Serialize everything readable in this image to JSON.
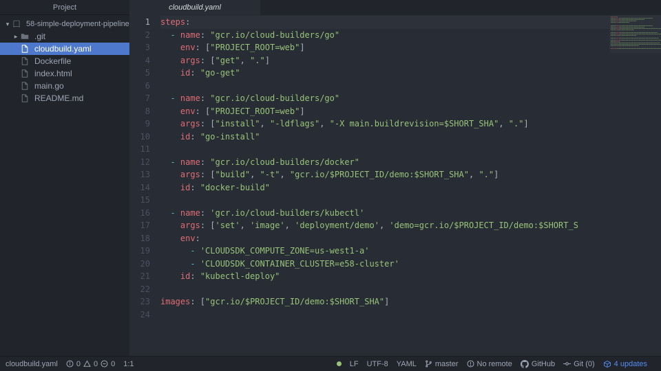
{
  "sidebar": {
    "title": "Project",
    "project": "58-simple-deployment-pipeline",
    "items": [
      {
        "name": ".git",
        "type": "folder"
      },
      {
        "name": "cloudbuild.yaml",
        "type": "file",
        "selected": true
      },
      {
        "name": "Dockerfile",
        "type": "file"
      },
      {
        "name": "index.html",
        "type": "file"
      },
      {
        "name": "main.go",
        "type": "file"
      },
      {
        "name": "README.md",
        "type": "file"
      }
    ]
  },
  "tab": {
    "name": "cloudbuild.yaml"
  },
  "code": {
    "lines": [
      [
        {
          "t": "steps",
          "c": "k"
        },
        {
          "t": ":",
          "c": "p"
        }
      ],
      [
        {
          "t": "  ",
          "c": "p"
        },
        {
          "t": "- ",
          "c": "d"
        },
        {
          "t": "name",
          "c": "k"
        },
        {
          "t": ": ",
          "c": "p"
        },
        {
          "t": "\"gcr.io/cloud-builders/go\"",
          "c": "s"
        }
      ],
      [
        {
          "t": "    ",
          "c": "p"
        },
        {
          "t": "env",
          "c": "k"
        },
        {
          "t": ": [",
          "c": "p"
        },
        {
          "t": "\"PROJECT_ROOT=web\"",
          "c": "s"
        },
        {
          "t": "]",
          "c": "p"
        }
      ],
      [
        {
          "t": "    ",
          "c": "p"
        },
        {
          "t": "args",
          "c": "k"
        },
        {
          "t": ": [",
          "c": "p"
        },
        {
          "t": "\"get\"",
          "c": "s"
        },
        {
          "t": ", ",
          "c": "p"
        },
        {
          "t": "\".\"",
          "c": "s"
        },
        {
          "t": "]",
          "c": "p"
        }
      ],
      [
        {
          "t": "    ",
          "c": "p"
        },
        {
          "t": "id",
          "c": "k"
        },
        {
          "t": ": ",
          "c": "p"
        },
        {
          "t": "\"go-get\"",
          "c": "s"
        }
      ],
      [],
      [
        {
          "t": "  ",
          "c": "p"
        },
        {
          "t": "- ",
          "c": "d"
        },
        {
          "t": "name",
          "c": "k"
        },
        {
          "t": ": ",
          "c": "p"
        },
        {
          "t": "\"gcr.io/cloud-builders/go\"",
          "c": "s"
        }
      ],
      [
        {
          "t": "    ",
          "c": "p"
        },
        {
          "t": "env",
          "c": "k"
        },
        {
          "t": ": [",
          "c": "p"
        },
        {
          "t": "\"PROJECT_ROOT=web\"",
          "c": "s"
        },
        {
          "t": "]",
          "c": "p"
        }
      ],
      [
        {
          "t": "    ",
          "c": "p"
        },
        {
          "t": "args",
          "c": "k"
        },
        {
          "t": ": [",
          "c": "p"
        },
        {
          "t": "\"install\"",
          "c": "s"
        },
        {
          "t": ", ",
          "c": "p"
        },
        {
          "t": "\"-ldflags\"",
          "c": "s"
        },
        {
          "t": ", ",
          "c": "p"
        },
        {
          "t": "\"-X main.buildrevision=$SHORT_SHA\"",
          "c": "s"
        },
        {
          "t": ", ",
          "c": "p"
        },
        {
          "t": "\".\"",
          "c": "s"
        },
        {
          "t": "]",
          "c": "p"
        }
      ],
      [
        {
          "t": "    ",
          "c": "p"
        },
        {
          "t": "id",
          "c": "k"
        },
        {
          "t": ": ",
          "c": "p"
        },
        {
          "t": "\"go-install\"",
          "c": "s"
        }
      ],
      [],
      [
        {
          "t": "  ",
          "c": "p"
        },
        {
          "t": "- ",
          "c": "d"
        },
        {
          "t": "name",
          "c": "k"
        },
        {
          "t": ": ",
          "c": "p"
        },
        {
          "t": "\"gcr.io/cloud-builders/docker\"",
          "c": "s"
        }
      ],
      [
        {
          "t": "    ",
          "c": "p"
        },
        {
          "t": "args",
          "c": "k"
        },
        {
          "t": ": [",
          "c": "p"
        },
        {
          "t": "\"build\"",
          "c": "s"
        },
        {
          "t": ", ",
          "c": "p"
        },
        {
          "t": "\"-t\"",
          "c": "s"
        },
        {
          "t": ", ",
          "c": "p"
        },
        {
          "t": "\"gcr.io/$PROJECT_ID/demo:$SHORT_SHA\"",
          "c": "s"
        },
        {
          "t": ", ",
          "c": "p"
        },
        {
          "t": "\".\"",
          "c": "s"
        },
        {
          "t": "]",
          "c": "p"
        }
      ],
      [
        {
          "t": "    ",
          "c": "p"
        },
        {
          "t": "id",
          "c": "k"
        },
        {
          "t": ": ",
          "c": "p"
        },
        {
          "t": "\"docker-build\"",
          "c": "s"
        }
      ],
      [],
      [
        {
          "t": "  ",
          "c": "p"
        },
        {
          "t": "- ",
          "c": "d"
        },
        {
          "t": "name",
          "c": "k"
        },
        {
          "t": ": ",
          "c": "p"
        },
        {
          "t": "'gcr.io/cloud-builders/kubectl'",
          "c": "s"
        }
      ],
      [
        {
          "t": "    ",
          "c": "p"
        },
        {
          "t": "args",
          "c": "k"
        },
        {
          "t": ": [",
          "c": "p"
        },
        {
          "t": "'set'",
          "c": "s"
        },
        {
          "t": ", ",
          "c": "p"
        },
        {
          "t": "'image'",
          "c": "s"
        },
        {
          "t": ", ",
          "c": "p"
        },
        {
          "t": "'deployment/demo'",
          "c": "s"
        },
        {
          "t": ", ",
          "c": "p"
        },
        {
          "t": "'demo=gcr.io/$PROJECT_ID/demo:$SHORT_S",
          "c": "s"
        }
      ],
      [
        {
          "t": "    ",
          "c": "p"
        },
        {
          "t": "env",
          "c": "k"
        },
        {
          "t": ":",
          "c": "p"
        }
      ],
      [
        {
          "t": "      ",
          "c": "p"
        },
        {
          "t": "- ",
          "c": "d"
        },
        {
          "t": "'CLOUDSDK_COMPUTE_ZONE=us-west1-a'",
          "c": "s"
        }
      ],
      [
        {
          "t": "      ",
          "c": "p"
        },
        {
          "t": "- ",
          "c": "d"
        },
        {
          "t": "'CLOUDSDK_CONTAINER_CLUSTER=e58-cluster'",
          "c": "s"
        }
      ],
      [
        {
          "t": "    ",
          "c": "p"
        },
        {
          "t": "id",
          "c": "k"
        },
        {
          "t": ": ",
          "c": "p"
        },
        {
          "t": "\"kubectl-deploy\"",
          "c": "s"
        }
      ],
      [],
      [
        {
          "t": "images",
          "c": "k"
        },
        {
          "t": ": [",
          "c": "p"
        },
        {
          "t": "\"gcr.io/$PROJECT_ID/demo:$SHORT_SHA\"",
          "c": "s"
        },
        {
          "t": "]",
          "c": "p"
        }
      ],
      []
    ],
    "cursor_line": 1
  },
  "status": {
    "filename": "cloudbuild.yaml",
    "diag_info": "0",
    "diag_warn": "0",
    "diag_err": "0",
    "cursor": "1:1",
    "line_ending": "LF",
    "encoding": "UTF-8",
    "lang": "YAML",
    "branch": "master",
    "remote": "No remote",
    "github": "GitHub",
    "git": "Git (0)",
    "updates": "4 updates"
  }
}
